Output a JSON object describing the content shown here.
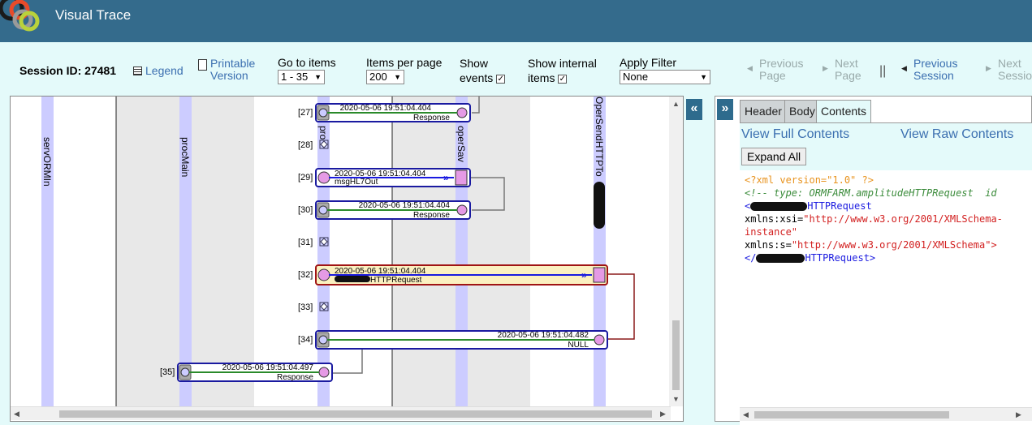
{
  "header": {
    "title": "Visual Trace"
  },
  "toolbar": {
    "session_label": "Session ID: 27481",
    "legend": "Legend",
    "printable_line1": "Printable",
    "printable_line2": "Version",
    "goto_label": "Go to items",
    "goto_value": "1 - 35",
    "ipp_label": "Items per page",
    "ipp_value": "200",
    "show_events_line1": "Show",
    "show_events_line2": "events",
    "show_internal_line1": "Show internal",
    "show_internal_line2": "items",
    "filter_label": "Apply Filter",
    "filter_value": "None",
    "prev_page_1": "Previous",
    "prev_page_2": "Page",
    "next_page_1": "Next",
    "next_page_2": "Page",
    "sep": "||",
    "prev_session_1": "Previous",
    "prev_session_2": "Session",
    "next_session_1": "Next",
    "next_session_2": "Session"
  },
  "collapse": {
    "left": "«",
    "right": "»"
  },
  "lanes": {
    "a": "servORMIn",
    "b": "procMain",
    "c": "pro",
    "d": "operSav",
    "e": "OperSendHTTPTo"
  },
  "rows": [
    {
      "id": "r27",
      "num": "[27]",
      "time": "2020-05-06 19:51:04.404",
      "msg": "Response"
    },
    {
      "id": "r28",
      "num": "[28]"
    },
    {
      "id": "r29",
      "num": "[29]",
      "time": "2020-05-06 19:51:04.404",
      "msg": "msgHL7Out"
    },
    {
      "id": "r30",
      "num": "[30]",
      "time": "2020-05-06 19:51:04.404",
      "msg": "Response"
    },
    {
      "id": "r31",
      "num": "[31]"
    },
    {
      "id": "r32",
      "num": "[32]",
      "time": "2020-05-06 19:51:04.404",
      "msg": "HTTPRequest"
    },
    {
      "id": "r33",
      "num": "[33]"
    },
    {
      "id": "r34",
      "num": "[34]",
      "time": "2020-05-06 19:51:04.482",
      "msg": "NULL"
    },
    {
      "id": "r35",
      "num": "[35]",
      "time": "2020-05-06 19:51:04.497",
      "msg": "Response"
    }
  ],
  "tabs": {
    "header": "Header",
    "body": "Body",
    "contents": "Contents"
  },
  "contents": {
    "view_full": "View Full Contents",
    "view_raw": "View Raw Contents",
    "expand_all": "Expand All"
  },
  "xml": {
    "pi": "<?xml version=\"1.0\" ?>",
    "comment": "<!-- type: ORMFARM.amplitudeHTTPRequest  id",
    "open_tag_suffix": "HTTPRequest",
    "ns1_attr": "xmlns:xsi",
    "ns1_val": "\"http://www.w3.org/2001/XMLSchema-",
    "ns1_val2": "instance\"",
    "ns2_attr": "xmlns:s",
    "ns2_val": "\"http://www.w3.org/2001/XMLSchema\">",
    "close_tag_suffix": "HTTPRequest>"
  },
  "colors": {
    "header_bg": "#346b8c",
    "page_bg": "#e4fafa",
    "lane": "#ccccff",
    "box_border": "#1a1aa0",
    "selected_border": "#a01414",
    "selected_fill": "#fbf0c0",
    "green_line": "#2a8a2a",
    "link": "#3b6fb0"
  }
}
